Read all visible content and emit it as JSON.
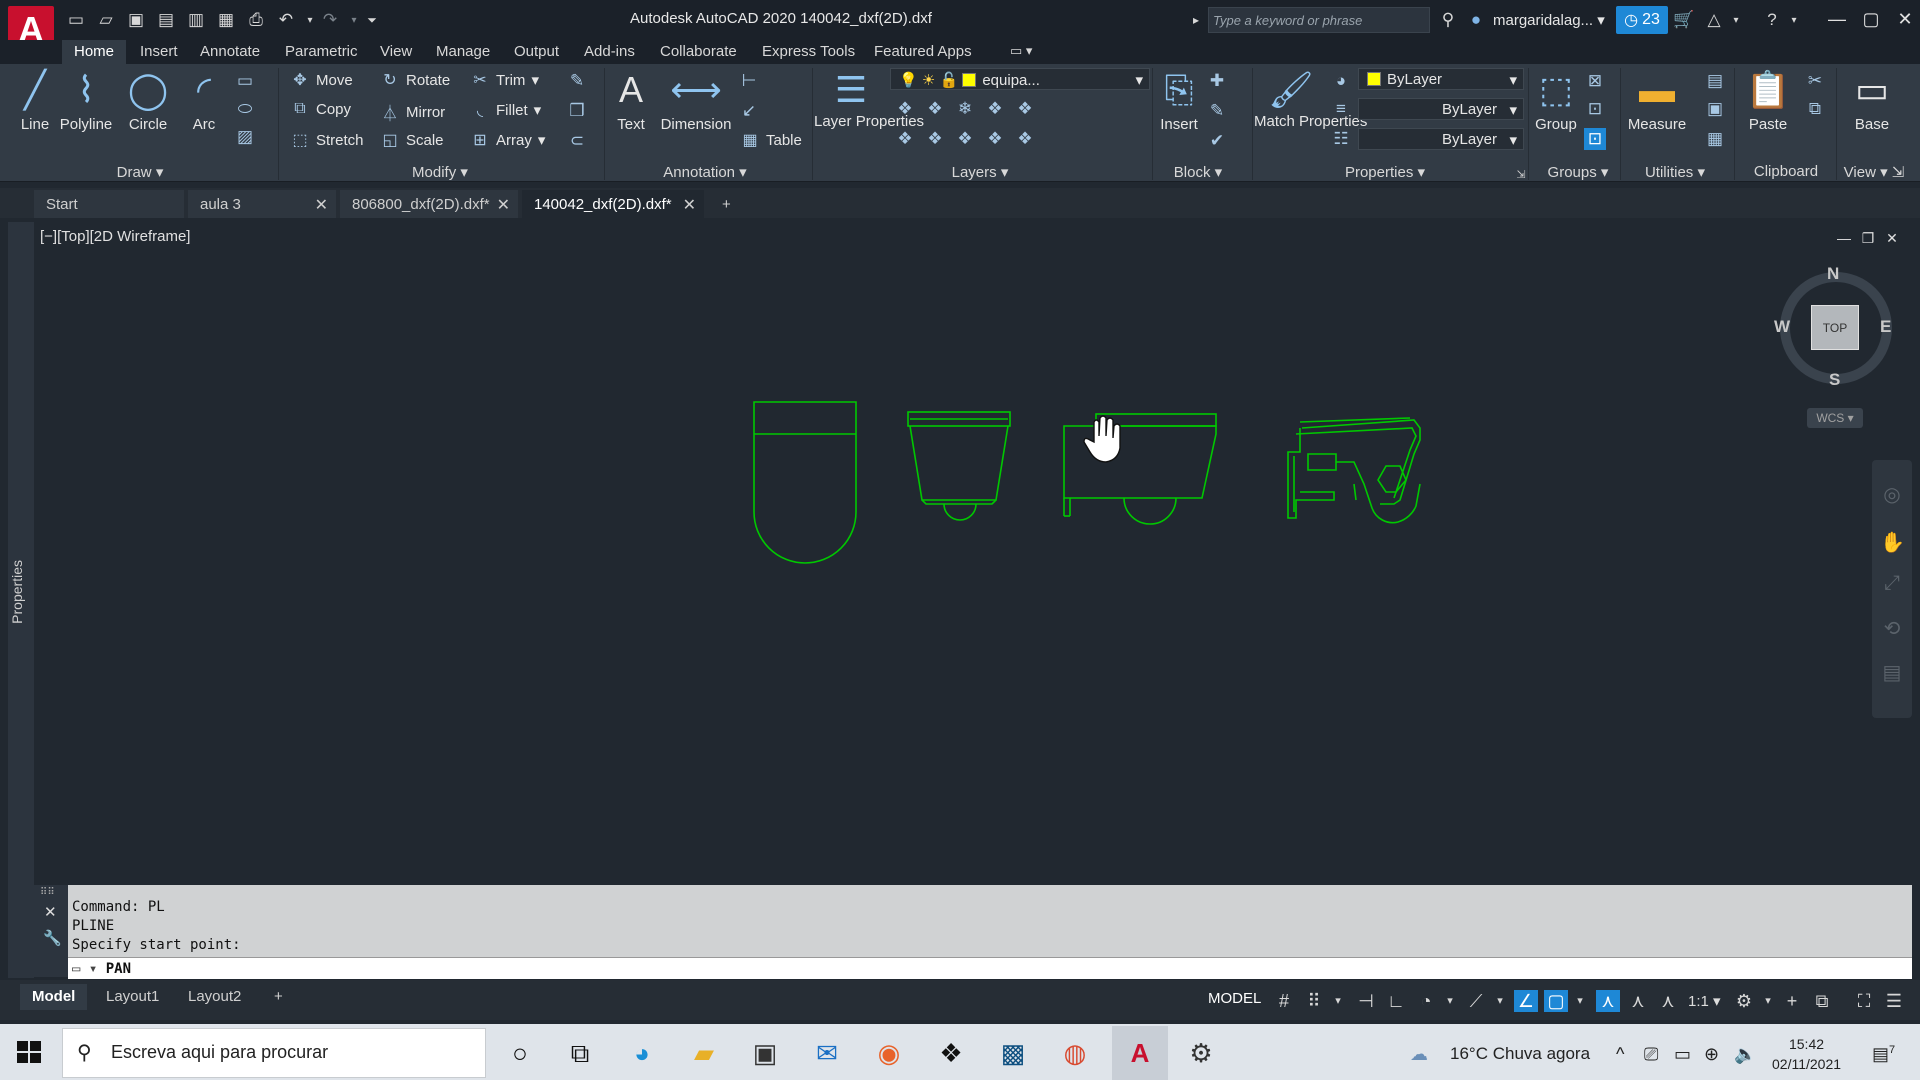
{
  "title_bar": {
    "app_title": "Autodesk AutoCAD 2020   140042_dxf(2D).dxf",
    "search_placeholder": "Type a keyword or phrase",
    "user": "margaridalag...",
    "notification_count": "23"
  },
  "ribbon_tabs": [
    "Home",
    "Insert",
    "Annotate",
    "Parametric",
    "View",
    "Manage",
    "Output",
    "Add-ins",
    "Collaborate",
    "Express Tools",
    "Featured Apps"
  ],
  "draw": {
    "title": "Draw",
    "line": "Line",
    "polyline": "Polyline",
    "circle": "Circle",
    "arc": "Arc"
  },
  "modify": {
    "title": "Modify",
    "move": "Move",
    "rotate": "Rotate",
    "trim": "Trim",
    "copy": "Copy",
    "mirror": "Mirror",
    "fillet": "Fillet",
    "stretch": "Stretch",
    "scale": "Scale",
    "array": "Array"
  },
  "annotation": {
    "title": "Annotation",
    "text": "Text",
    "dimension": "Dimension",
    "table": "Table"
  },
  "layers": {
    "title": "Layers",
    "layer_properties": "Layer Properties",
    "current_layer": "equipa..."
  },
  "block": {
    "title": "Block",
    "insert": "Insert"
  },
  "properties": {
    "title": "Properties",
    "match_properties": "Match Properties",
    "color": "ByLayer",
    "linetype": "ByLayer",
    "lineweight": "ByLayer"
  },
  "groups": {
    "title": "Groups",
    "group": "Group"
  },
  "utilities": {
    "title": "Utilities",
    "measure": "Measure"
  },
  "clipboard": {
    "title": "Clipboard",
    "paste": "Paste"
  },
  "view_panel": {
    "title": "View",
    "base": "Base"
  },
  "doc_tabs": [
    {
      "label": "Start"
    },
    {
      "label": "aula 3"
    },
    {
      "label": "806800_dxf(2D).dxf*"
    },
    {
      "label": "140042_dxf(2D).dxf*"
    }
  ],
  "viewport": {
    "label": "[−][Top][2D Wireframe]",
    "properties_palette": "Properties",
    "viewcube_top": "TOP",
    "compass": {
      "n": "N",
      "s": "S",
      "e": "E",
      "w": "W"
    },
    "wcs": "WCS"
  },
  "command": {
    "history": [
      "Command: PL",
      "PLINE",
      "Specify start point:"
    ],
    "input": "PAN"
  },
  "layout_tabs": [
    "Model",
    "Layout1",
    "Layout2"
  ],
  "status": {
    "model": "MODEL",
    "scale": "1:1"
  },
  "taskbar": {
    "search_placeholder": "Escreva aqui para procurar",
    "weather": "16°C  Chuva agora",
    "time": "15:42",
    "date": "02/11/2021",
    "notifications": "7"
  },
  "colors": {
    "canvas": "#212830",
    "geometry": "#00c800",
    "accent": "#1e88d6",
    "logo": "#c8102e"
  }
}
